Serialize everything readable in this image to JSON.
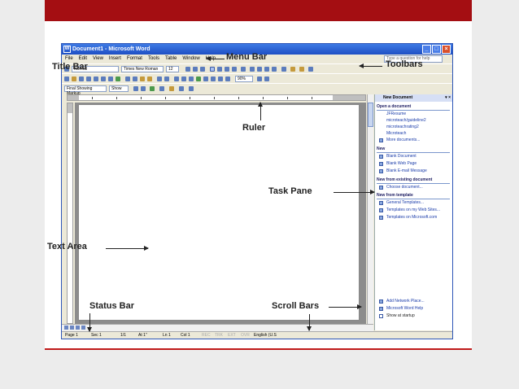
{
  "window": {
    "title": "Document1 - Microsoft Word",
    "app_icon": "word-app-icon",
    "buttons": [
      "_",
      "□",
      "×"
    ]
  },
  "menu": {
    "items": [
      "File",
      "Edit",
      "View",
      "Insert",
      "Format",
      "Tools",
      "Table",
      "Window",
      "Help"
    ],
    "help_box_placeholder": "Type a question for help"
  },
  "toolbar": {
    "style": "Normal",
    "font": "Times New Roman",
    "size": "12",
    "zoom": "90%",
    "markup": "Final Showing Markup",
    "show": "Show"
  },
  "task_pane": {
    "title": "New Document",
    "sections": {
      "open": "Open a document",
      "new": "New",
      "existing": "New from existing document",
      "template": "New from template"
    },
    "open_links": [
      "JFResume",
      "microteach/guideline2",
      "microteachrating2",
      "Microteach",
      "More documents..."
    ],
    "new_links": [
      "Blank Document",
      "Blank Web Page",
      "Blank E-mail Message"
    ],
    "existing_links": [
      "Choose document..."
    ],
    "template_links": [
      "General Templates...",
      "Templates on my Web Sites...",
      "Templates on Microsoft.com"
    ],
    "bottom_links": [
      "Add Network Place...",
      "Microsoft Word Help",
      "Show at startup"
    ]
  },
  "status": {
    "page": "Page 1",
    "sec": "Sec 1",
    "pages": "1/1",
    "at": "At 1\"",
    "ln": "Ln 1",
    "col": "Col 1",
    "rec": "REC",
    "trk": "TRK",
    "ext": "EXT",
    "ovr": "OVR",
    "lang": "English (U.S"
  },
  "labels": {
    "menu_bar": "Menu Bar",
    "title_bar": "Title Bar",
    "toolbars": "Toolbars",
    "ruler": "Ruler",
    "task_pane": "Task Pane",
    "text_area": "Text Area",
    "status_bar": "Status Bar",
    "scroll_bars": "Scroll Bars"
  },
  "colors": {
    "top_band": "#a40e12",
    "title_bar": "#1f4fc4"
  }
}
